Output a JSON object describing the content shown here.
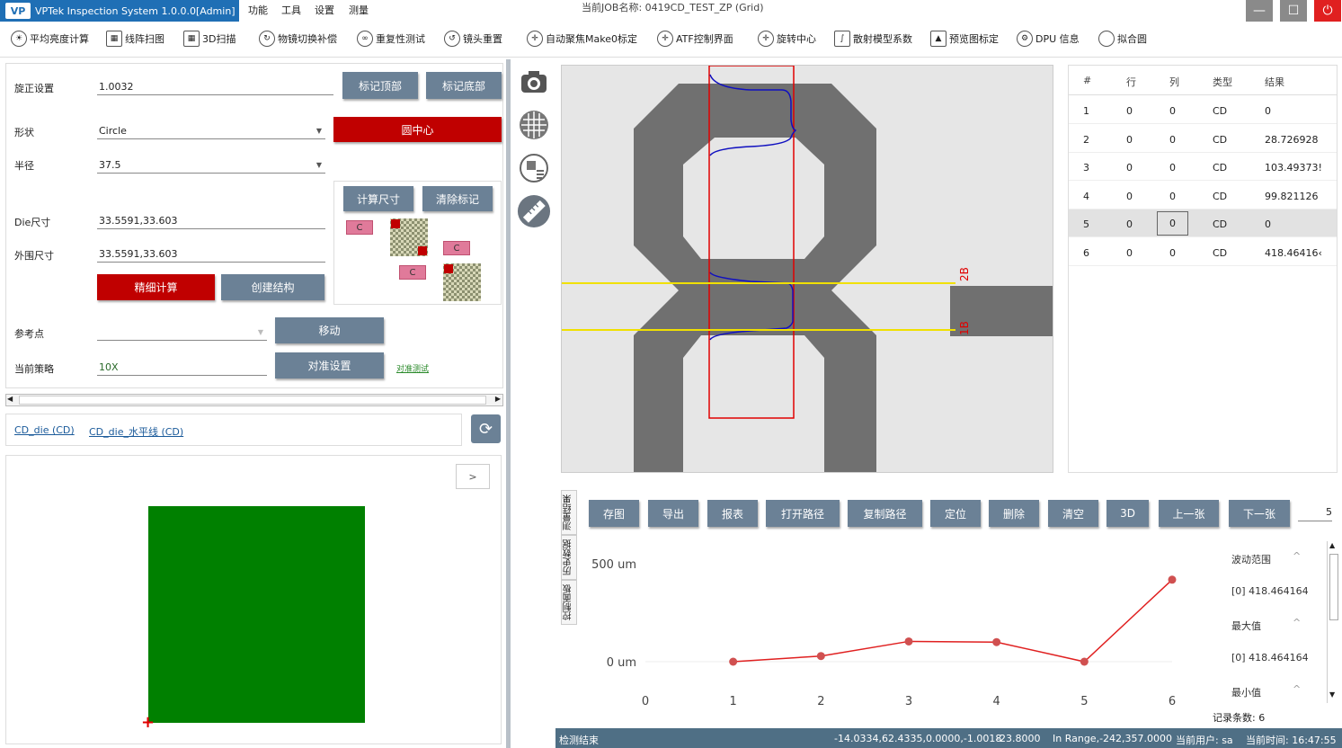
{
  "app": {
    "title": "VPTek Inspection System 1.0.0.0[Admin]",
    "logo": "VP",
    "job_label": "当前JOB名称:  0419CD_TEST_ZP (Grid)",
    "menu": [
      "功能",
      "工具",
      "设置",
      "测量"
    ],
    "window_buttons": {
      "minimize": "—",
      "maximize": "☐",
      "close": "⏻"
    }
  },
  "toolbar": [
    {
      "label": "平均亮度计算",
      "icon": "sun-icon"
    },
    {
      "label": "线阵扫图",
      "icon": "scan-icon"
    },
    {
      "label": "3D扫描",
      "icon": "3d-scan-icon"
    },
    {
      "label": "物镜切换补偿",
      "icon": "lens-switch-icon"
    },
    {
      "label": "重复性测试",
      "icon": "repeat-icon"
    },
    {
      "label": "镜头重置",
      "icon": "reset-icon"
    },
    {
      "label": "自动聚焦Make0标定",
      "icon": "crosshair-icon"
    },
    {
      "label": "ATF控制界面",
      "icon": "crosshair-icon"
    },
    {
      "label": "旋转中心",
      "icon": "rotate-icon"
    },
    {
      "label": "散射模型系数",
      "icon": "curve-icon"
    },
    {
      "label": "预览图标定",
      "icon": "image-icon"
    },
    {
      "label": "DPU 信息",
      "icon": "gear-icon"
    },
    {
      "label": "拟合圆",
      "icon": "circle-icon"
    }
  ],
  "left": {
    "rotation_label": "旋正设置",
    "rotation_value": "1.0032",
    "mark_top": "标记顶部",
    "mark_bottom": "标记底部",
    "shape_label": "形状",
    "shape_value": "Circle",
    "circle_center": "圆中心",
    "radius_label": "半径",
    "radius_value": "37.5",
    "calc_size": "计算尺寸",
    "clear_mark": "清除标记",
    "die_label": "Die尺寸",
    "die_value": "33.5591,33.603",
    "outer_label": "外围尺寸",
    "outer_value": "33.5591,33.603",
    "fine_calc": "精细计算",
    "create_struct": "创建结构",
    "ref_label": "参考点",
    "ref_value": "",
    "move": "移动",
    "strategy_label": "当前策略",
    "strategy_value": "10X",
    "align_settings": "对准设置",
    "align_test": "对准测试",
    "box_c": "C",
    "tabs": [
      "CD_die (CD)",
      "CD_die_水平线 (CD)"
    ],
    "expand": ">"
  },
  "viewer": {
    "labels": [
      "2B",
      "1B"
    ]
  },
  "results": {
    "headers": [
      "#",
      "行",
      "列",
      "类型",
      "结果"
    ],
    "rows": [
      [
        "1",
        "0",
        "0",
        "CD",
        "0"
      ],
      [
        "2",
        "0",
        "0",
        "CD",
        "28.726928"
      ],
      [
        "3",
        "0",
        "0",
        "CD",
        "103.49373!"
      ],
      [
        "4",
        "0",
        "0",
        "CD",
        "99.821126"
      ],
      [
        "5",
        "0",
        "0",
        "CD",
        "0"
      ],
      [
        "6",
        "0",
        "0",
        "CD",
        "418.46416‹"
      ]
    ]
  },
  "bottom_buttons": [
    "存图",
    "导出",
    "报表",
    "打开路径",
    "复制路径",
    "定位",
    "删除",
    "清空",
    "3D",
    "上一张",
    "下一张"
  ],
  "page_value": "5",
  "vtabs": [
    "测量结果",
    "历史数据",
    "控制面板"
  ],
  "chart_data": {
    "type": "line",
    "x": [
      1,
      2,
      3,
      4,
      5,
      6
    ],
    "y": [
      0,
      28.726928,
      103.49373,
      99.821126,
      0,
      418.464164
    ],
    "ytick_labels": [
      "500 um",
      "0 um"
    ],
    "xtick_labels": [
      "0",
      "1",
      "2",
      "3",
      "4",
      "5",
      "6"
    ],
    "xlim": [
      0,
      6
    ],
    "ylim": [
      0,
      500
    ],
    "line_color": "#e02020",
    "marker_color": "#d05050"
  },
  "stats": {
    "range_label": "波动范围",
    "range_value": "[0]   418.464164",
    "max_label": "最大值",
    "max_value": "[0]   418.464164",
    "min_label": "最小值",
    "count_label": "记录条数: 6"
  },
  "status": {
    "state": "检测结束",
    "coords": "-14.0334,62.4335,0.0000,-1.0018",
    "z": "-23.8000",
    "range": "In Range,-242,357.0000",
    "user": "当前用户:  sa",
    "time": "当前时间:  16:47:55"
  }
}
